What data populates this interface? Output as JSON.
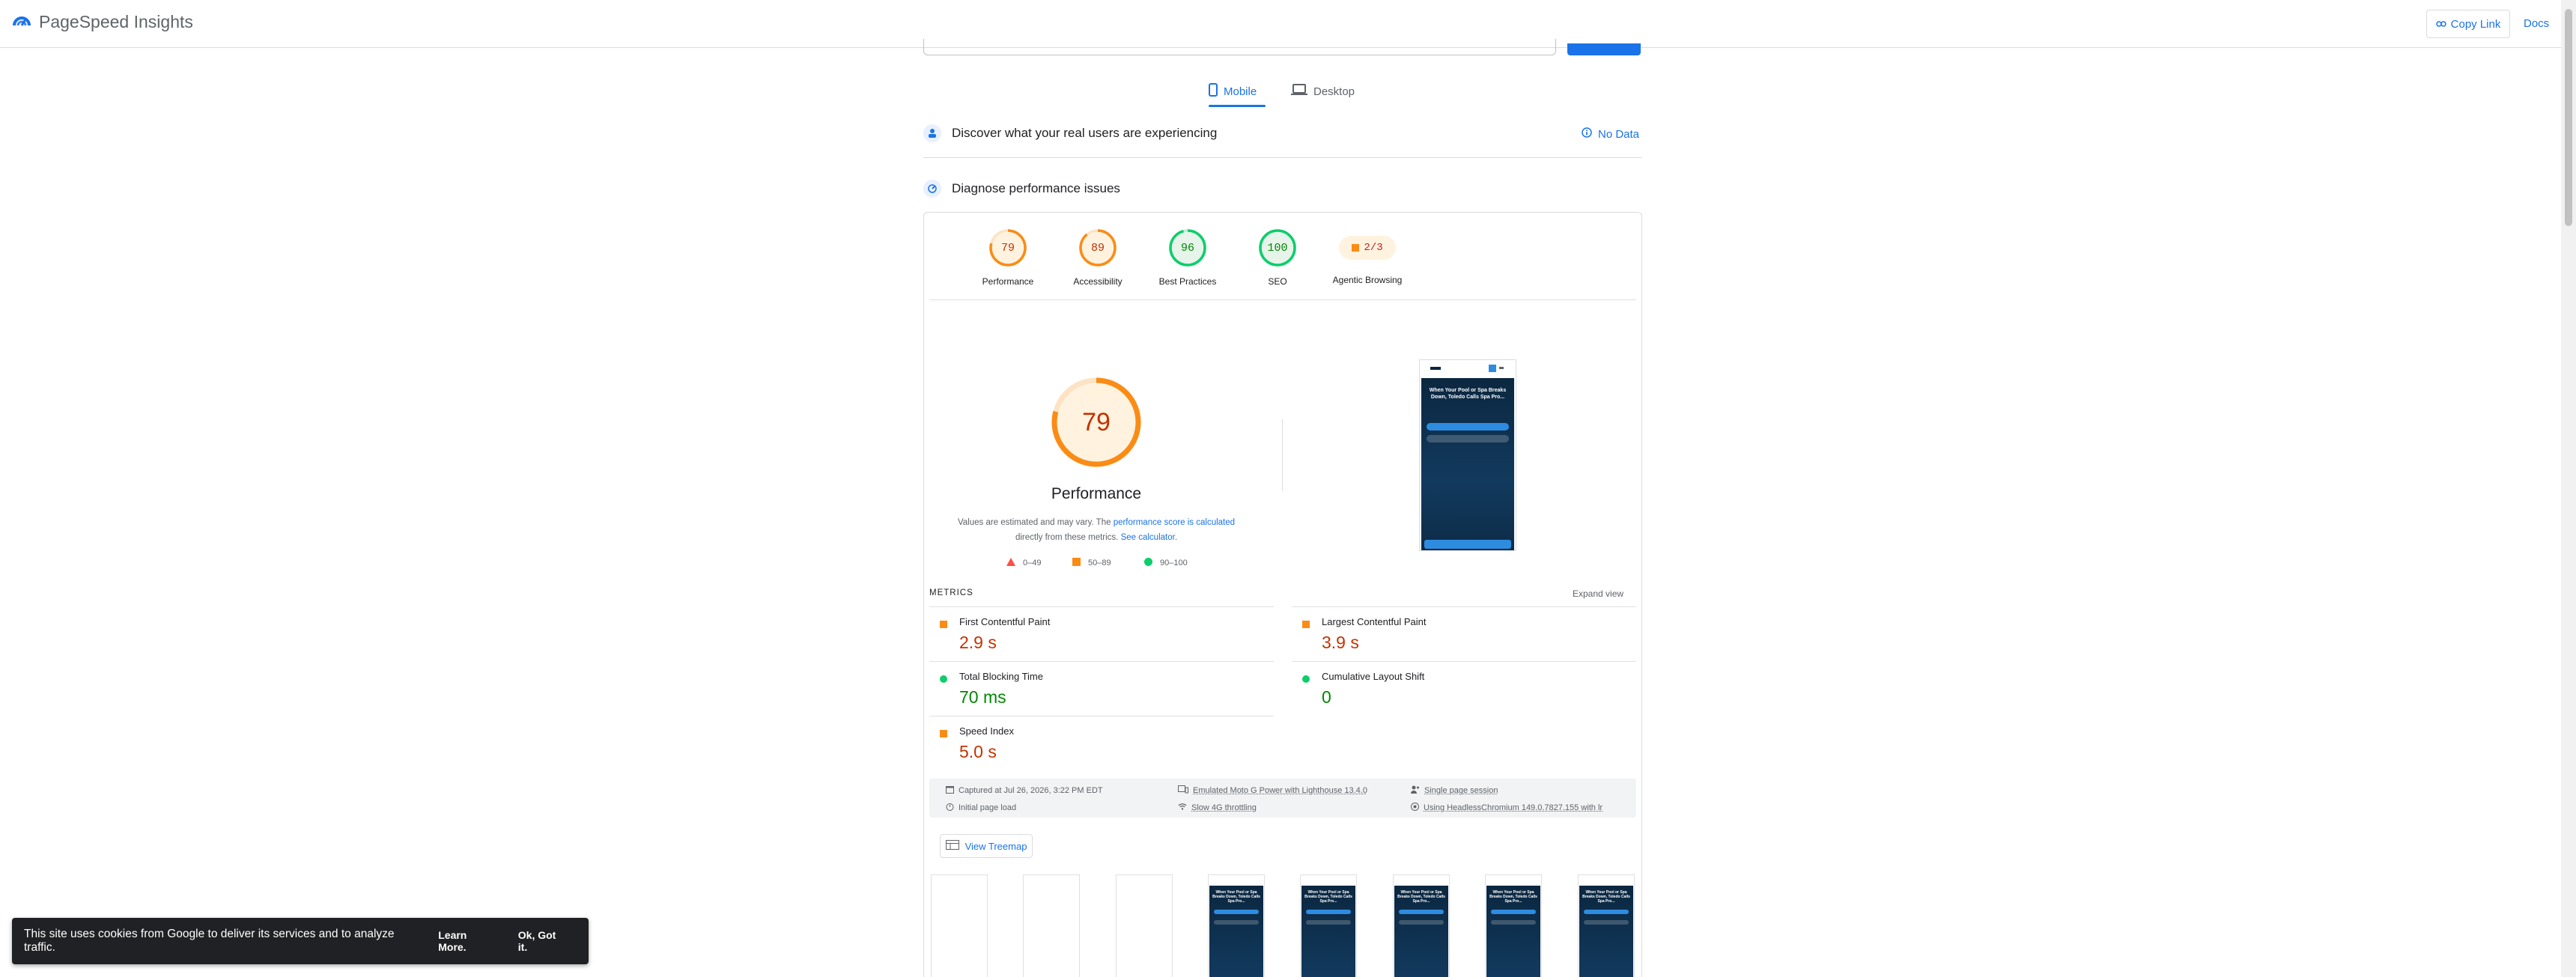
{
  "header": {
    "brand": "PageSpeed Insights",
    "copy_link": "Copy Link",
    "docs": "Docs"
  },
  "tabs": {
    "mobile": "Mobile",
    "desktop": "Desktop"
  },
  "sections": {
    "real_users": "Discover what your real users are experiencing",
    "no_data": "No Data",
    "diagnose": "Diagnose performance issues"
  },
  "gauges": [
    {
      "label": "Performance",
      "score": "79",
      "value": 79,
      "status": "average"
    },
    {
      "label": "Accessibility",
      "score": "89",
      "value": 89,
      "status": "average"
    },
    {
      "label": "Best Practices",
      "score": "96",
      "value": 96,
      "status": "pass"
    },
    {
      "label": "SEO",
      "score": "100",
      "value": 100,
      "status": "pass"
    },
    {
      "label": "Agentic Browsing",
      "score": "2/3",
      "value": 67,
      "status": "average"
    }
  ],
  "main_score": {
    "value": "79",
    "title": "Performance",
    "estimate_pre": "Values are estimated and may vary. The ",
    "estimate_link": "performance score is calculated",
    "estimate_mid": " directly from these metrics. ",
    "calc_link": "See calculator."
  },
  "legend": {
    "fail": "0–49",
    "average": "50–89",
    "pass": "90–100"
  },
  "phone": {
    "headline": "When Your Pool or Spa Breaks Down, Toledo Calls Spa Pro..."
  },
  "metrics_section": {
    "label": "METRICS",
    "expand": "Expand view"
  },
  "metrics": [
    {
      "name": "First Contentful Paint",
      "value": "2.9 s",
      "status": "average"
    },
    {
      "name": "Largest Contentful Paint",
      "value": "3.9 s",
      "status": "average"
    },
    {
      "name": "Total Blocking Time",
      "value": "70 ms",
      "status": "pass"
    },
    {
      "name": "Cumulative Layout Shift",
      "value": "0",
      "status": "pass"
    },
    {
      "name": "Speed Index",
      "value": "5.0 s",
      "status": "average"
    }
  ],
  "info": {
    "captured": "Captured at Jul 26, 2026, 3:22 PM EDT",
    "initial": "Initial page load",
    "device": "Emulated Moto G Power with Lighthouse 13.4.0",
    "throttling": "Slow 4G throttling",
    "session": "Single page session",
    "browser": "Using HeadlessChromium 149.0.7827.155 with lr"
  },
  "treemap": "View Treemap",
  "cookie": {
    "message": "This site uses cookies from Google to deliver its services and to analyze traffic.",
    "learn_more": "Learn More.",
    "ok": "Ok, Got it."
  },
  "colors": {
    "blue": "#1a73e8",
    "average": "#fa8c16",
    "pass": "#0cce6b",
    "fail": "#ff4e42"
  }
}
